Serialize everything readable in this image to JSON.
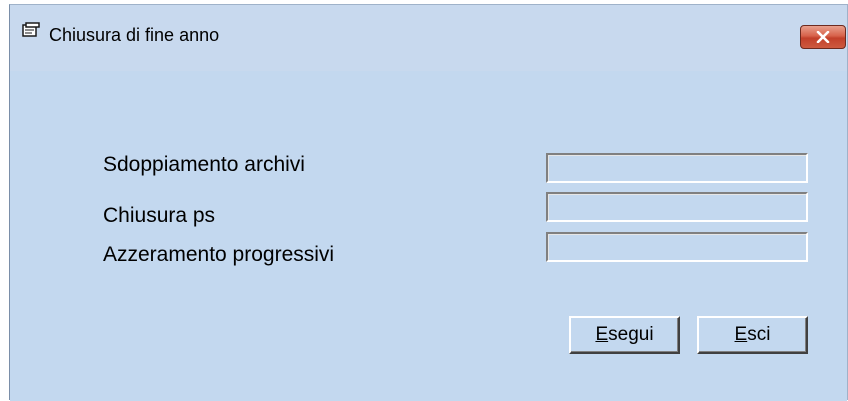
{
  "window": {
    "title": "Chiusura di fine anno",
    "close_symbol": "X",
    "icon": "window-app-icon"
  },
  "rows": [
    {
      "label": "Sdoppiamento archivi",
      "value": ""
    },
    {
      "label": "Chiusura ps",
      "value": ""
    },
    {
      "label": "Azzeramento progressivi",
      "value": ""
    }
  ],
  "buttons": {
    "run": {
      "accel": "E",
      "rest": "segui"
    },
    "exit": {
      "accel": "E",
      "rest": "sci"
    }
  },
  "colors": {
    "background": "#c3d8ef",
    "close_button": "#c2402a"
  }
}
